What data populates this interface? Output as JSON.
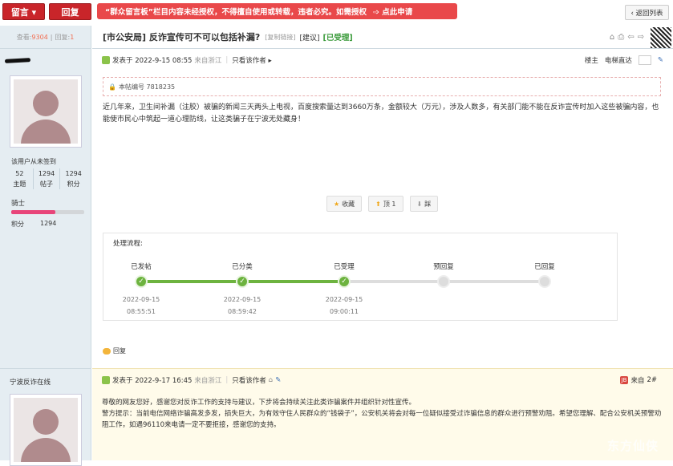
{
  "topbar": {
    "message_button": "留言 ▾",
    "reply_button": "回复",
    "notice_text": "“群众留言板”栏目内容未经授权，不得擅自使用或转载，违者必究。如需授权",
    "notice_link": "➩ 点此申请",
    "back_button": "‹ 返回列表"
  },
  "stats_bar": {
    "views_label": "查看:",
    "views": "9304",
    "replies_label": "回复:",
    "replies": "1"
  },
  "thread": {
    "title": "[市公安局] 反诈宣传可不可以包括补漏?",
    "copy_link": "[复制链接]",
    "category": "[建议]",
    "status": "[已受理]"
  },
  "op": {
    "posted_label": "发表于 2022-9-15 08:55",
    "origin": "来自浙江",
    "only_author": "只看该作者 ▸",
    "floor_label": "楼主",
    "jump_label": "电梯直达",
    "ticket_label": "本帖编号 7818235",
    "content": "近几年来，卫生间补漏（注胶）被骗的新闻三天两头上电视，百度搜索量达到3660万条，金额较大（万元），涉及人数多，有关部门能不能在反诈宣传时加入这些被骗内容，也能使市民心中筑起一道心理防线，让这类骗子在宁波无处藏身！"
  },
  "user1": {
    "signin": "该用户从未签到",
    "stats": [
      {
        "value": "52",
        "label": "主题"
      },
      {
        "value": "1294",
        "label": "帖子"
      },
      {
        "value": "1294",
        "label": "积分"
      }
    ],
    "rank": "骑士",
    "rank_progress": 0.6,
    "points_label": "积分",
    "points": "1294"
  },
  "actions": {
    "favorite": "收藏",
    "up": "顶 1",
    "down": "踩"
  },
  "flow": {
    "title": "处理流程:",
    "steps": [
      {
        "label": "已发帖",
        "date": "2022-09-15",
        "time": "08:55:51",
        "done": true
      },
      {
        "label": "已分类",
        "date": "2022-09-15",
        "time": "08:59:42",
        "done": true
      },
      {
        "label": "已受理",
        "date": "2022-09-15",
        "time": "09:00:11",
        "done": true
      },
      {
        "label": "预回复",
        "date": "",
        "time": "",
        "done": false
      },
      {
        "label": "已回复",
        "date": "",
        "time": "",
        "done": false
      }
    ]
  },
  "reply_link": "回复",
  "reply_post": {
    "username": "宁波反诈在线",
    "posted_label": "发表于 2022-9-17 16:45",
    "origin": "来自浙江",
    "only_author": "只看该作者",
    "floor": "2#",
    "floor_prefix": "来自",
    "line1": "尊敬的网友您好，感谢您对反诈工作的支持与建议，下步将会持续关注此类诈骗案件并组织针对性宣传。",
    "line2": "警方提示：当前电信网络诈骗高发多发，损失巨大，为有效守住人民群众的“钱袋子”，公安机关将会对每一位疑似接受过诈骗信息的群众进行预警劝阻。希望您理解、配合公安机关预警劝阻工作，如遇96110来电请一定不要拒接，感谢您的支持。"
  },
  "watermark": "东方仙侠"
}
